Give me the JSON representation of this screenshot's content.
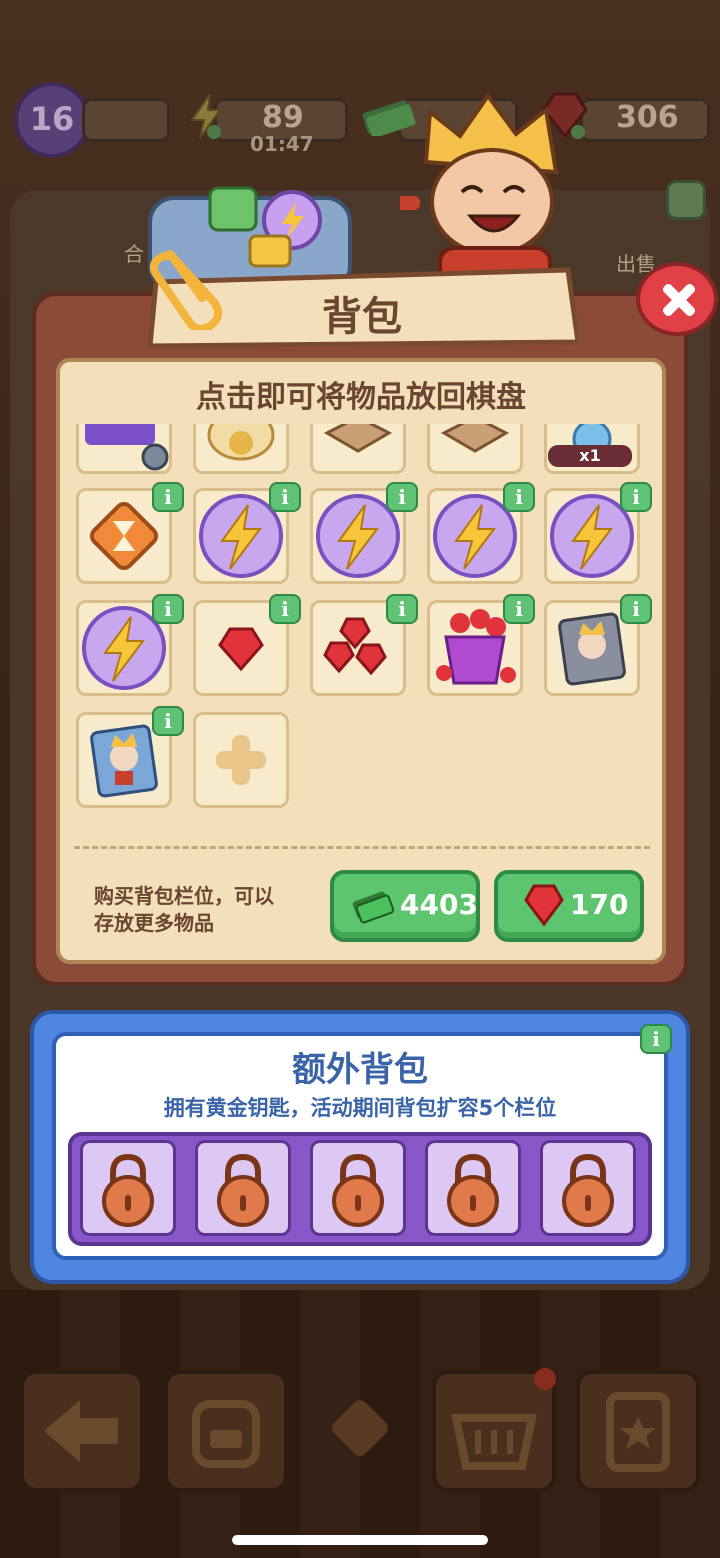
{
  "hud": {
    "level": "16",
    "energy": "89",
    "energy_timer": "01:47",
    "cash_partial": "",
    "gems": "306"
  },
  "background": {
    "sell_label": "出售",
    "merge_label_partial": "合"
  },
  "backpack": {
    "title": "背包",
    "hint": "点击即可将物品放回棋盘",
    "partial_item_qty": "x1",
    "buy_text_line1": "购买背包栏位，可以",
    "buy_text_line2": "存放更多物品",
    "buy_cash_price": "4403",
    "buy_gem_price": "170",
    "items": [
      {
        "name": "hourglass-tile",
        "has_info": true
      },
      {
        "name": "energy-orb",
        "has_info": true
      },
      {
        "name": "energy-orb",
        "has_info": true
      },
      {
        "name": "energy-orb",
        "has_info": true
      },
      {
        "name": "energy-orb",
        "has_info": true
      },
      {
        "name": "energy-orb",
        "has_info": true
      },
      {
        "name": "single-ruby",
        "has_info": true
      },
      {
        "name": "ruby-pile",
        "has_info": true
      },
      {
        "name": "ruby-basket",
        "has_info": true
      },
      {
        "name": "character-card-gray",
        "has_info": true
      },
      {
        "name": "character-card-blue",
        "has_info": true
      },
      {
        "name": "add-slot",
        "has_info": false
      }
    ]
  },
  "extra_bag": {
    "title": "额外背包",
    "subtitle": "拥有黄金钥匙，活动期间背包扩容5个栏位",
    "locked_slots": 5
  },
  "colors": {
    "panel_brown": "#8c4b38",
    "cream": "#f3dfb9",
    "green_button": "#5cc56d",
    "blue_panel": "#4f86e2",
    "purple_tray": "#8a57c9",
    "close_red": "#e04046"
  }
}
